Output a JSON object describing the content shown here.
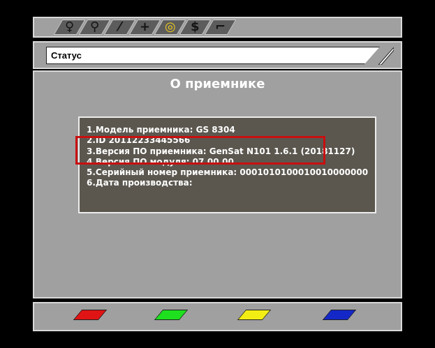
{
  "tabs": [
    {
      "icon": "magnifier-icon",
      "glyph": "♀",
      "active": false
    },
    {
      "icon": "wrench-icon",
      "glyph": "⚲",
      "active": false
    },
    {
      "icon": "brush-icon",
      "glyph": "⁄",
      "active": false
    },
    {
      "icon": "plus-icon",
      "glyph": "+",
      "active": false
    },
    {
      "icon": "disc-icon",
      "glyph": "◎",
      "active": true
    },
    {
      "icon": "dollar-icon",
      "glyph": "$",
      "active": false
    },
    {
      "icon": "satellite-dish-icon",
      "glyph": "⌐",
      "active": false
    }
  ],
  "status": {
    "label": "Статус"
  },
  "page": {
    "title": "О приемнике"
  },
  "info": {
    "lines": [
      "1.Модель приемника: GS 8304",
      "2.ID 20112233445566",
      "3.Версия ПО приемника: GenSat N101 1.6.1 (20181127)",
      "4.Версия ПО модуля: 07.00.00",
      "5.Серийный номер приемника: 0001010100010010000000",
      "6.Дата производства:"
    ]
  },
  "color_keys": [
    {
      "icon": "red-key-icon",
      "color": "#e01414"
    },
    {
      "icon": "green-key-icon",
      "color": "#1ee01e"
    },
    {
      "icon": "yellow-key-icon",
      "color": "#f2ee14"
    },
    {
      "icon": "blue-key-icon",
      "color": "#1428c8"
    }
  ],
  "colors": {
    "background": "#000000",
    "panel": "#a0a0a0",
    "info_box": "#5b574f",
    "highlight": "#c90f0f",
    "active_tab": "#f2cc1a"
  }
}
